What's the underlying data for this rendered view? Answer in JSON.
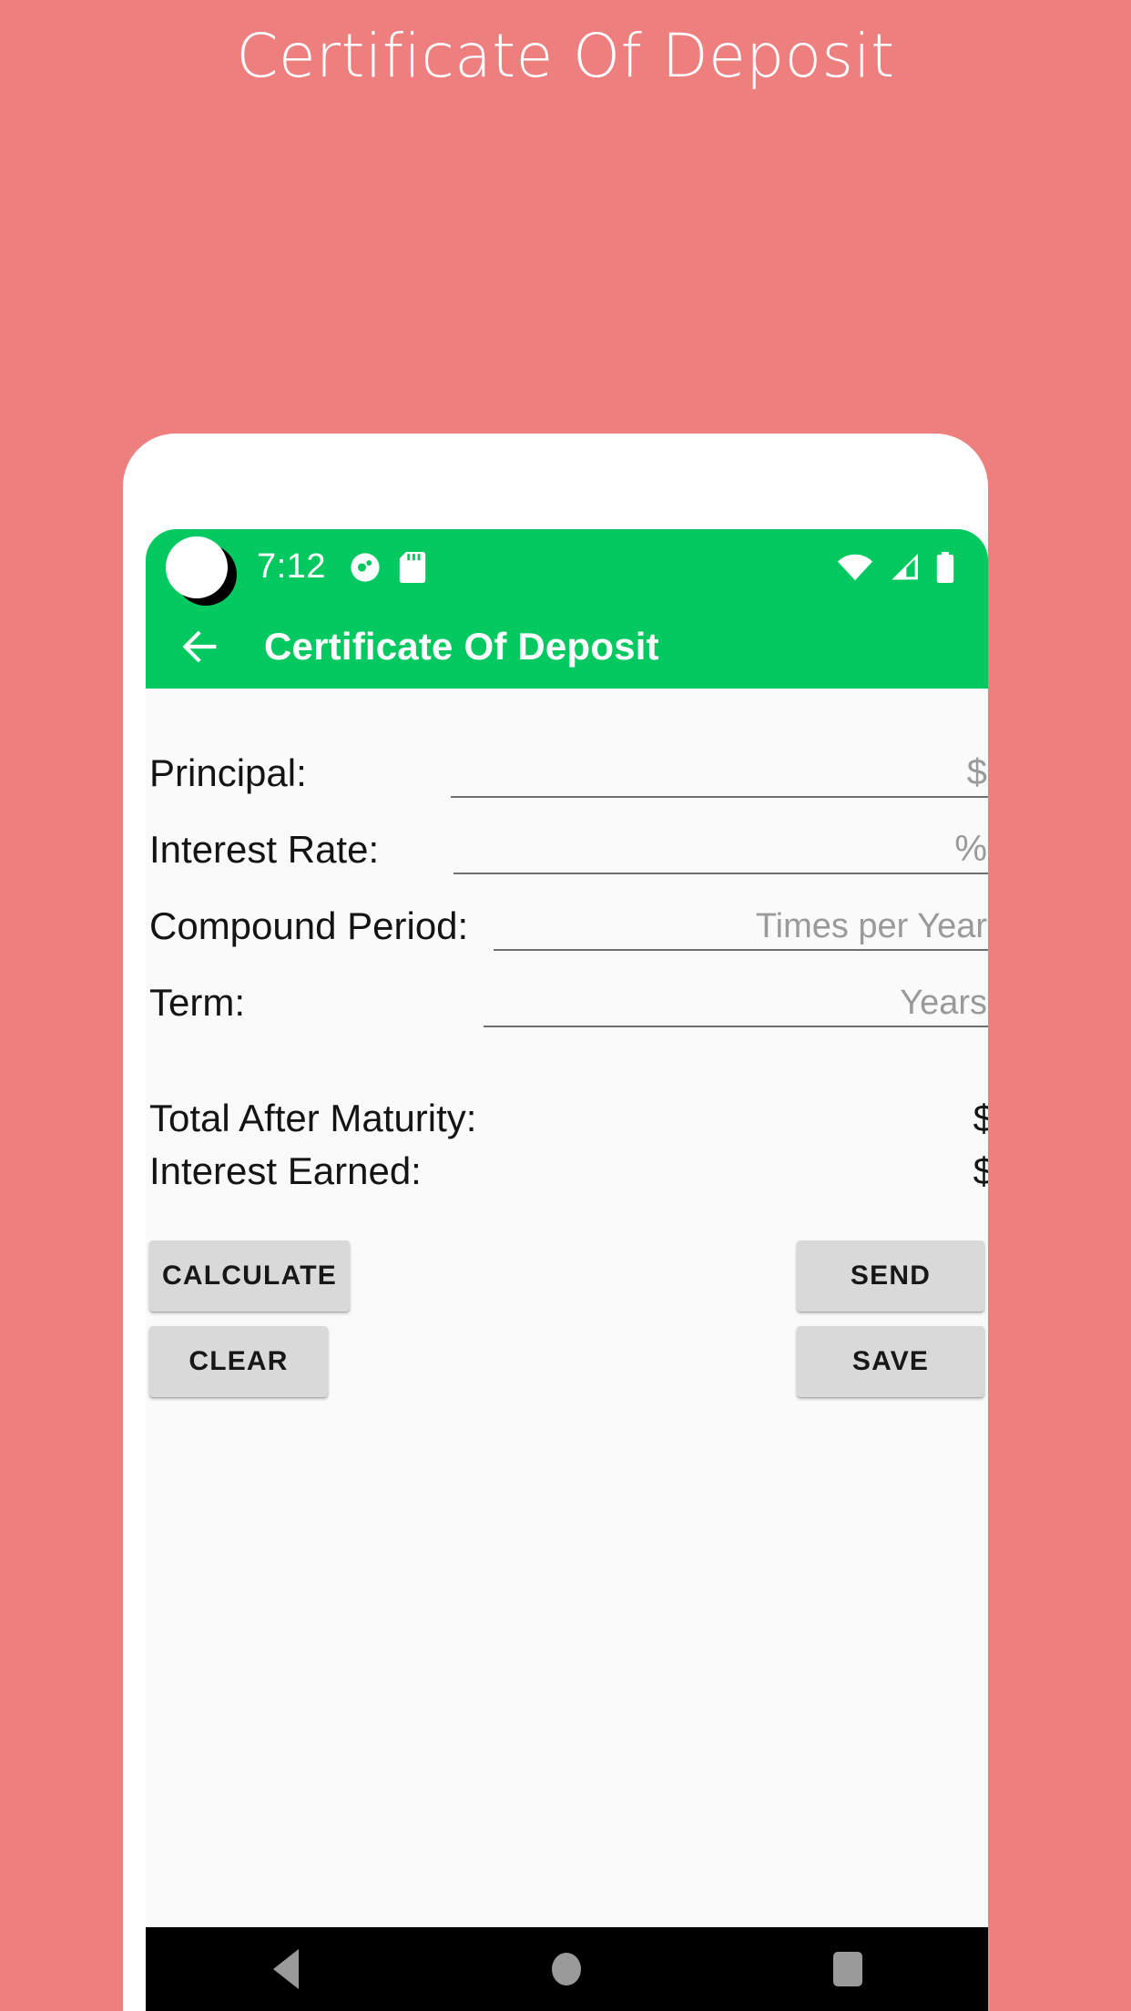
{
  "page": {
    "heading": "Certificate Of Deposit",
    "background_color": "#ee7f7f",
    "heading_color": "#ffffff"
  },
  "status_bar": {
    "time": "7:12",
    "background_color": "#04c860",
    "left_icons": [
      "app-circle-icon",
      "sd-card-icon"
    ],
    "right_icons": [
      "wifi-icon",
      "signal-icon",
      "battery-icon"
    ]
  },
  "app_bar": {
    "title": "Certificate Of Deposit",
    "back_icon": "arrow-left-icon",
    "background_color": "#04c860",
    "title_color": "#ffffff"
  },
  "form": {
    "fields": [
      {
        "label": "Principal:",
        "value": "",
        "hint": "$",
        "name": "principal"
      },
      {
        "label": "Interest Rate:",
        "value": "",
        "hint": "%",
        "name": "interest-rate"
      },
      {
        "label": "Compound Period:",
        "value": "",
        "hint": "Times per Year",
        "name": "compound-period"
      },
      {
        "label": "Term:",
        "value": "",
        "hint": "Years",
        "name": "term"
      }
    ]
  },
  "results": [
    {
      "label": "Total After Maturity:",
      "value": "$",
      "name": "total-after-maturity"
    },
    {
      "label": "Interest Earned:",
      "value": "$",
      "name": "interest-earned"
    }
  ],
  "buttons": {
    "calculate": "CALCULATE",
    "send": "SEND",
    "clear": "CLEAR",
    "save": "SAVE",
    "background_color": "#d9d9d9",
    "text_color": "#171717"
  },
  "nav_bar": {
    "background_color": "#000000",
    "icon_color": "#9a9a9a",
    "items": [
      "back-triangle-icon",
      "home-circle-icon",
      "recents-square-icon"
    ]
  }
}
